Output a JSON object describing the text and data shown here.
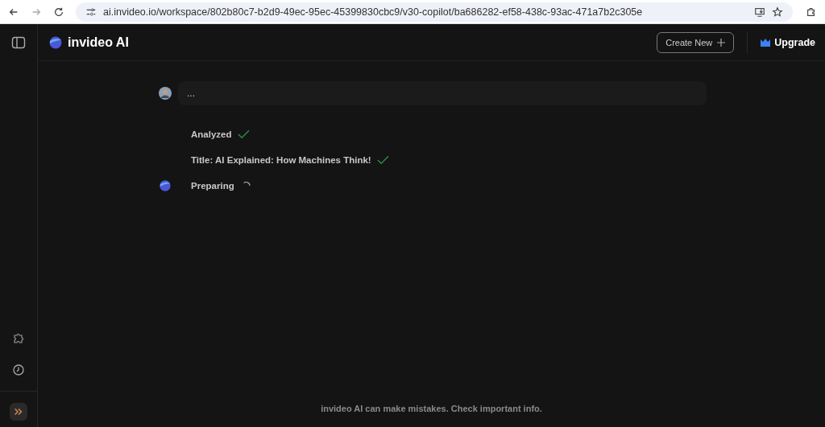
{
  "browser": {
    "url": "ai.invideo.io/workspace/802b80c7-b2d9-49ec-95ec-45399830cbc9/v30-copilot/ba686282-ef58-438c-93ac-471a7b2c305e"
  },
  "header": {
    "brand": "invideo AI",
    "create_button": "Create New",
    "upgrade_button": "Upgrade"
  },
  "chat": {
    "user_message": "...",
    "steps": [
      {
        "kind": "done",
        "text": "Analyzed"
      },
      {
        "kind": "done",
        "text": "Title: AI Explained: How Machines Think!"
      },
      {
        "kind": "loading",
        "text": "Preparing"
      }
    ]
  },
  "footer": {
    "disclaimer": "invideo AI can make mistakes. Check important info."
  }
}
